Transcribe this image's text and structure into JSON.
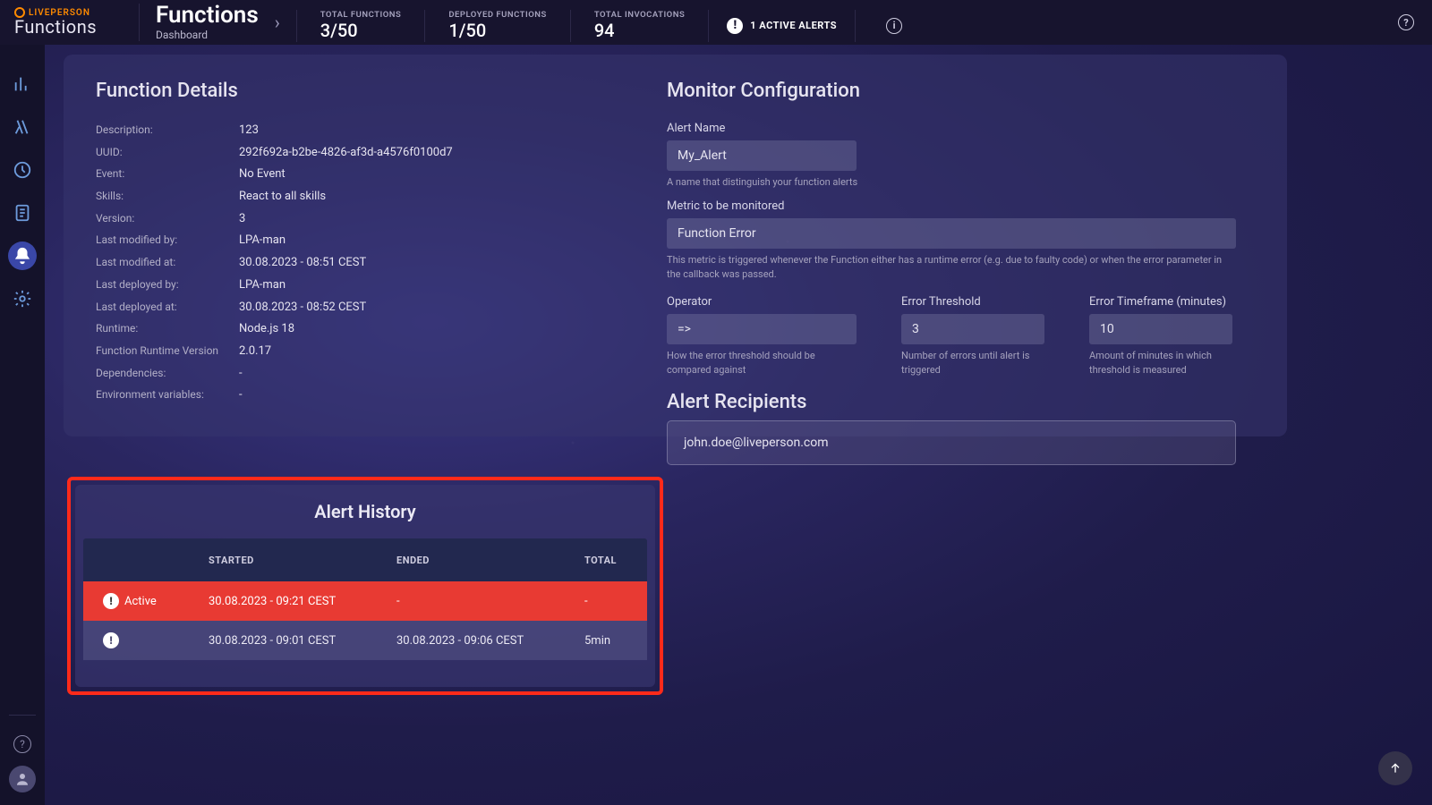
{
  "brand": {
    "top": "LIVEPERSON",
    "bottom": "Functions"
  },
  "breadcrumb": {
    "title": "Functions",
    "subtitle": "Dashboard"
  },
  "stats": {
    "total_functions": {
      "label": "TOTAL FUNCTIONS",
      "value": "3/50"
    },
    "deployed_functions": {
      "label": "DEPLOYED FUNCTIONS",
      "value": "1/50"
    },
    "total_invocations": {
      "label": "TOTAL INVOCATIONS",
      "value": "94"
    }
  },
  "active_alerts": {
    "text": "1 ACTIVE ALERTS"
  },
  "details": {
    "title": "Function Details",
    "rows": {
      "description": {
        "k": "Description:",
        "v": "123"
      },
      "uuid": {
        "k": "UUID:",
        "v": "292f692a-b2be-4826-af3d-a4576f0100d7"
      },
      "event": {
        "k": "Event:",
        "v": "No Event"
      },
      "skills": {
        "k": "Skills:",
        "v": "React to all skills"
      },
      "version": {
        "k": "Version:",
        "v": "3"
      },
      "last_modified_by": {
        "k": "Last modified by:",
        "v": "LPA-man"
      },
      "last_modified_at": {
        "k": "Last modified at:",
        "v": "30.08.2023 - 08:51 CEST"
      },
      "last_deployed_by": {
        "k": "Last deployed by:",
        "v": "LPA-man"
      },
      "last_deployed_at": {
        "k": "Last deployed at:",
        "v": "30.08.2023 - 08:52 CEST"
      },
      "runtime": {
        "k": "Runtime:",
        "v": "Node.js 18"
      },
      "fn_runtime_version": {
        "k": "Function Runtime Version",
        "v": "2.0.17"
      },
      "dependencies": {
        "k": "Dependencies:",
        "v": "-"
      },
      "env_vars": {
        "k": "Environment variables:",
        "v": "-"
      }
    }
  },
  "monitor": {
    "title": "Monitor Configuration",
    "alert_name": {
      "label": "Alert Name",
      "value": "My_Alert",
      "helper": "A name that distinguish your function alerts"
    },
    "metric": {
      "label": "Metric to be monitored",
      "value": "Function Error",
      "helper": "This metric is triggered whenever the Function either has a runtime error (e.g. due to faulty code) or when the error parameter in the callback was passed."
    },
    "operator": {
      "label": "Operator",
      "value": "=>",
      "helper": "How the error threshold should be compared against"
    },
    "threshold": {
      "label": "Error Threshold",
      "value": "3",
      "helper": "Number of errors until alert is triggered"
    },
    "timeframe": {
      "label": "Error Timeframe (minutes)",
      "value": "10",
      "helper": "Amount of minutes in which threshold is measured"
    },
    "recipients": {
      "title": "Alert Recipients",
      "value": "john.doe@liveperson.com"
    }
  },
  "history": {
    "title": "Alert History",
    "columns": {
      "started": "STARTED",
      "ended": "ENDED",
      "total": "TOTAL"
    },
    "rows": [
      {
        "status": "Active",
        "started": "30.08.2023 - 09:21 CEST",
        "ended": "-",
        "total": "-"
      },
      {
        "status": "",
        "started": "30.08.2023 - 09:01 CEST",
        "ended": "30.08.2023 - 09:06 CEST",
        "total": "5min"
      }
    ]
  }
}
